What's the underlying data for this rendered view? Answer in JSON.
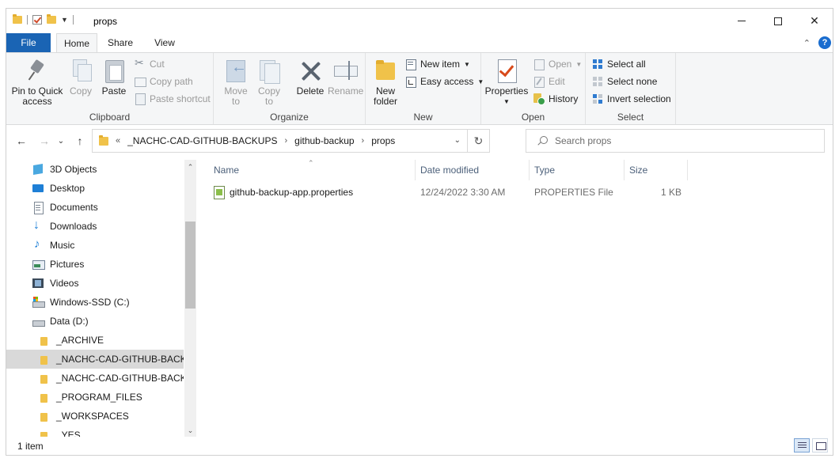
{
  "window": {
    "title": "props"
  },
  "ribbon": {
    "tabs": [
      "File",
      "Home",
      "Share",
      "View"
    ],
    "help": "?",
    "clipboard": {
      "label": "Clipboard",
      "pin": "Pin to Quick access",
      "pin_line1": "Pin to Quick",
      "pin_line2": "access",
      "copy": "Copy",
      "paste": "Paste",
      "cut": "Cut",
      "copy_path": "Copy path",
      "paste_shortcut": "Paste shortcut"
    },
    "organize": {
      "label": "Organize",
      "move_line1": "Move",
      "move_line2": "to",
      "copy_line1": "Copy",
      "copy_line2": "to",
      "delete": "Delete",
      "rename": "Rename"
    },
    "new": {
      "label": "New",
      "new_folder_line1": "New",
      "new_folder_line2": "folder",
      "new_item": "New item",
      "easy_access": "Easy access"
    },
    "open": {
      "label": "Open",
      "properties": "Properties",
      "open": "Open",
      "edit": "Edit",
      "history": "History"
    },
    "select": {
      "label": "Select",
      "select_all": "Select all",
      "select_none": "Select none",
      "invert": "Invert selection"
    }
  },
  "address": {
    "overflow": "«",
    "segments": [
      "_NACHC-CAD-GITHUB-BACKUPS",
      "github-backup",
      "props"
    ]
  },
  "search": {
    "placeholder": "Search props"
  },
  "navpane": {
    "items": [
      {
        "label": "3D Objects",
        "icon": "3d-objects-icon"
      },
      {
        "label": "Desktop",
        "icon": "desktop-icon"
      },
      {
        "label": "Documents",
        "icon": "documents-icon"
      },
      {
        "label": "Downloads",
        "icon": "downloads-icon"
      },
      {
        "label": "Music",
        "icon": "music-icon"
      },
      {
        "label": "Pictures",
        "icon": "pictures-icon"
      },
      {
        "label": "Videos",
        "icon": "videos-icon"
      },
      {
        "label": "Windows-SSD (C:)",
        "icon": "drive-c-icon"
      },
      {
        "label": "Data (D:)",
        "icon": "drive-d-icon"
      },
      {
        "label": "_ARCHIVE",
        "icon": "folder-icon"
      },
      {
        "label": "_NACHC-CAD-GITHUB-BACKUPS",
        "icon": "folder-icon"
      },
      {
        "label": "_NACHC-CAD-GITHUB-BACKUPS",
        "icon": "folder-icon"
      },
      {
        "label": "_PROGRAM_FILES",
        "icon": "folder-icon"
      },
      {
        "label": "_WORKSPACES",
        "icon": "folder-icon"
      },
      {
        "label": "_YES",
        "icon": "folder-icon"
      }
    ]
  },
  "filelist": {
    "columns": [
      "Name",
      "Date modified",
      "Type",
      "Size"
    ],
    "rows": [
      {
        "name": "github-backup-app.properties",
        "date": "12/24/2022 3:30 AM",
        "type": "PROPERTIES File",
        "size": "1 KB"
      }
    ]
  },
  "status": {
    "count": "1 item"
  }
}
